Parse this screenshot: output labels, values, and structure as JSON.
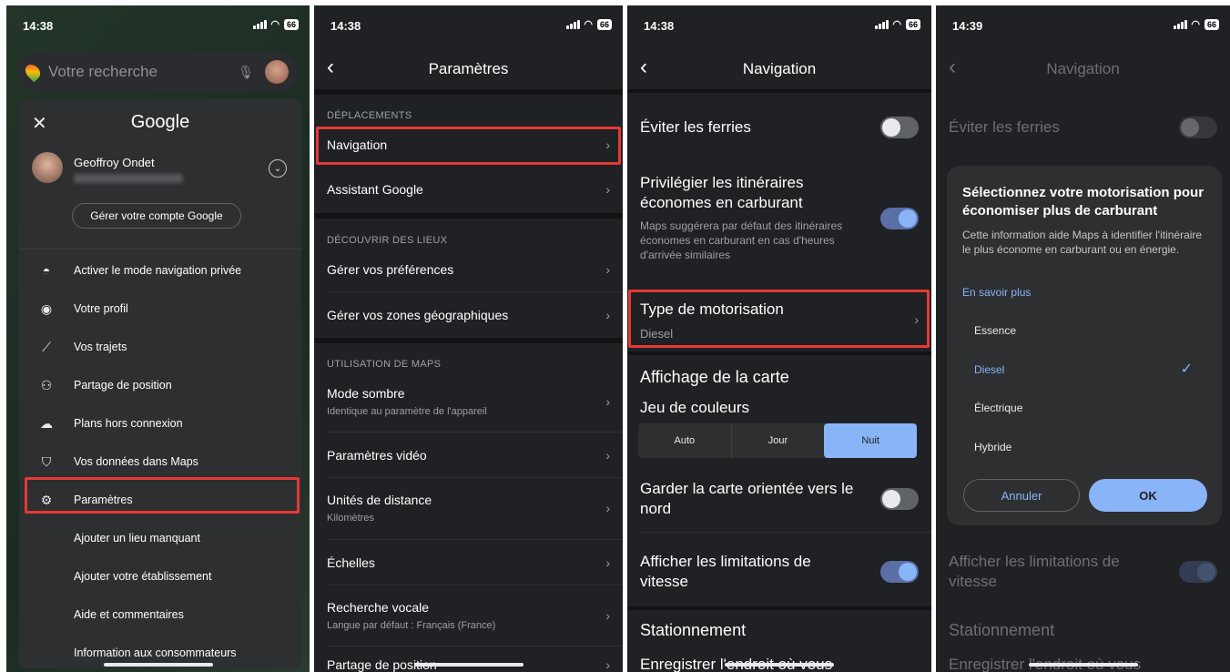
{
  "status": {
    "p1_time": "14:38",
    "p2_time": "14:38",
    "p3_time": "14:38",
    "p4_time": "14:39",
    "battery": "66"
  },
  "screen1": {
    "search_placeholder": "Votre recherche",
    "menu_title": "Google",
    "account_name": "Geoffroy Ondet",
    "manage_account": "Gérer votre compte Google",
    "items": [
      {
        "label": "Activer le mode navigation privée",
        "icon": "incognito-icon"
      },
      {
        "label": "Votre profil",
        "icon": "profile-icon"
      },
      {
        "label": "Vos trajets",
        "icon": "timeline-icon"
      },
      {
        "label": "Partage de position",
        "icon": "location-sharing-icon"
      },
      {
        "label": "Plans hors connexion",
        "icon": "offline-maps-icon"
      },
      {
        "label": "Vos données dans Maps",
        "icon": "shield-icon"
      },
      {
        "label": "Paramètres",
        "icon": "gear-icon"
      },
      {
        "label": "Ajouter un lieu manquant"
      },
      {
        "label": "Ajouter votre établissement"
      },
      {
        "label": "Aide et commentaires"
      },
      {
        "label": "Information aux consommateurs"
      }
    ]
  },
  "screen2": {
    "title": "Paramètres",
    "sec_deplacements": "DÉPLACEMENTS",
    "navigation": "Navigation",
    "assistant": "Assistant Google",
    "sec_lieux": "DÉCOUVRIR DES LIEUX",
    "prefs": "Gérer vos préférences",
    "zones": "Gérer vos zones géographiques",
    "sec_maps": "UTILISATION DE MAPS",
    "dark": "Mode sombre",
    "dark_sub": "Identique au paramètre de l'appareil",
    "video": "Paramètres vidéo",
    "units": "Unités de distance",
    "units_sub": "Kilomètres",
    "scales": "Échelles",
    "voice": "Recherche vocale",
    "voice_sub": "Langue par défaut : Français (France)",
    "sharing": "Partage de position"
  },
  "screen3": {
    "title": "Navigation",
    "ferries": "Éviter les ferries",
    "eco": "Privilégier les itinéraires économes en carburant",
    "eco_sub": "Maps suggérera par défaut des itinéraires économes en carburant en cas d'heures d'arrivée similaires",
    "engine": "Type de motorisation",
    "engine_sub": "Diesel",
    "map_display": "Affichage de la carte",
    "colors": "Jeu de couleurs",
    "seg": [
      "Auto",
      "Jour",
      "Nuit"
    ],
    "north": "Garder la carte orientée vers le nord",
    "speed": "Afficher les limitations de vitesse",
    "parking": "Stationnement",
    "save_spot": "Enregistrer l'endroit où vous"
  },
  "screen4": {
    "dialog_title": "Sélectionnez votre motorisation pour économiser plus de carburant",
    "dialog_desc": "Cette information aide Maps à identifier l'itinéraire le plus économe en carburant ou en énergie.",
    "learn_more": "En savoir plus",
    "options": [
      "Essence",
      "Diesel",
      "Électrique",
      "Hybride"
    ],
    "selected": "Diesel",
    "cancel": "Annuler",
    "ok": "OK"
  },
  "colors": {
    "accent": "#8ab4f8",
    "highlight": "#e53935",
    "bg": "#202124"
  }
}
